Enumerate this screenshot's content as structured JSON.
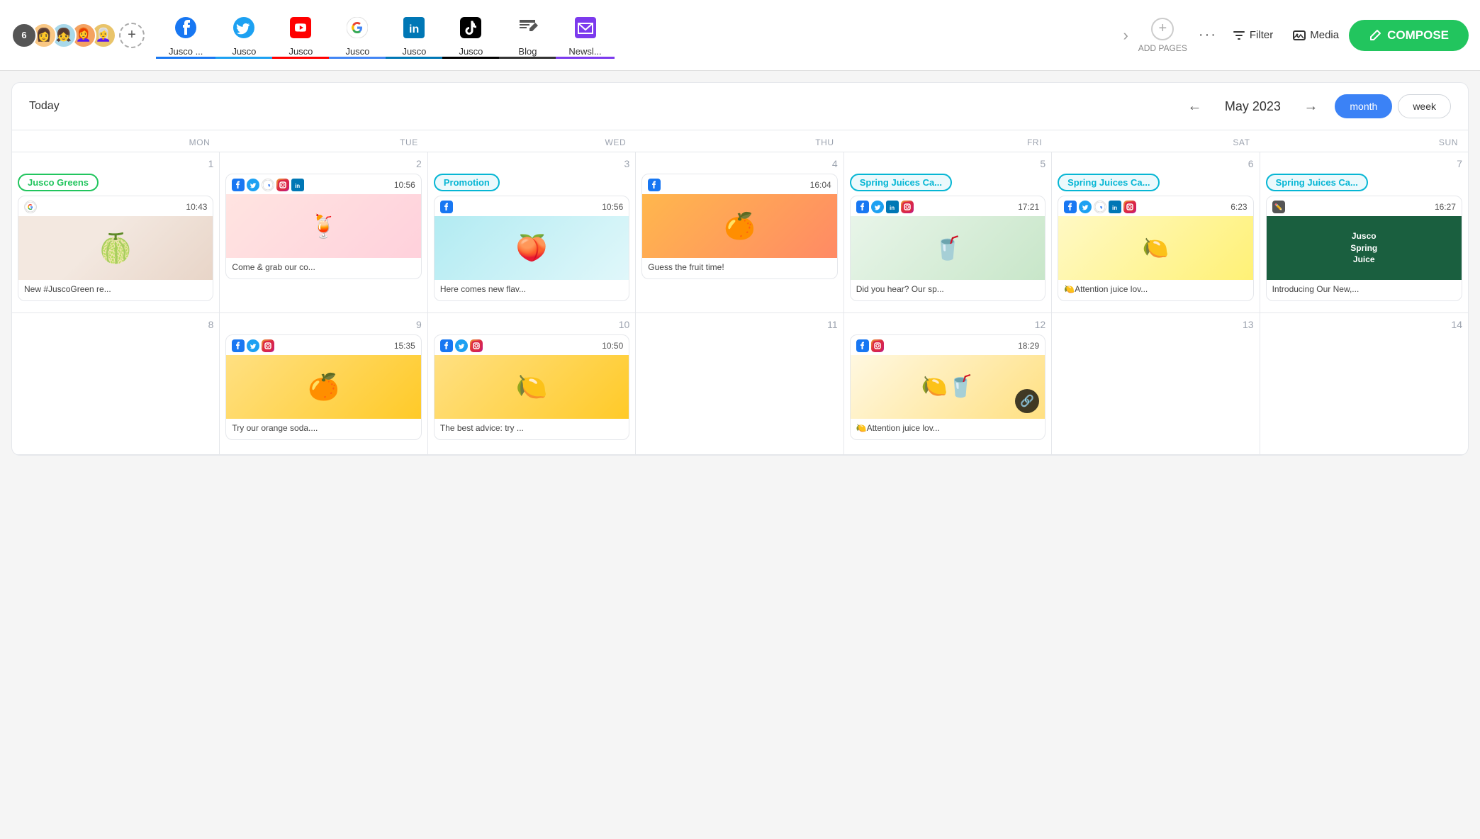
{
  "avatars": {
    "count": "6",
    "users": [
      "👩",
      "👧",
      "👩‍🦰",
      "👩‍🦳"
    ]
  },
  "tabs": [
    {
      "id": "fb",
      "label": "Jusco ...",
      "icon": "fb",
      "active_class": "active-fb"
    },
    {
      "id": "tw",
      "label": "Jusco",
      "icon": "tw",
      "active_class": "active-tw"
    },
    {
      "id": "yt",
      "label": "Jusco",
      "icon": "yt",
      "active_class": "active-yt"
    },
    {
      "id": "g",
      "label": "Jusco",
      "icon": "g",
      "active_class": "active-g"
    },
    {
      "id": "li",
      "label": "Jusco",
      "icon": "li",
      "active_class": "active-li"
    },
    {
      "id": "tk",
      "label": "Jusco",
      "icon": "tk",
      "active_class": "active-tk"
    },
    {
      "id": "blog",
      "label": "Blog",
      "icon": "blog",
      "active_class": "active-bl"
    },
    {
      "id": "nl",
      "label": "Newsl...",
      "icon": "nl",
      "active_class": "active-nl"
    }
  ],
  "nav": {
    "add_pages": "ADD PAGES",
    "more": "···",
    "filter": "Filter",
    "media": "Media",
    "compose": "COMPOSE"
  },
  "calendar": {
    "today": "Today",
    "month_year": "May 2023",
    "view_month": "month",
    "view_week": "week",
    "days": [
      "MON",
      "TUE",
      "WED",
      "THU",
      "FRI",
      "SAT",
      "SUN"
    ],
    "week1_nums": [
      "1",
      "2",
      "3",
      "4",
      "5",
      "6",
      "7"
    ],
    "week2_nums": [
      "8",
      "9",
      "10",
      "11",
      "12",
      "13",
      "14"
    ]
  },
  "posts": {
    "w1_mon": {
      "tag": "Jusco Greens",
      "tag_type": "green",
      "platform": "google",
      "time": "10:43",
      "caption": "New #JuscoGreen re...",
      "img_type": "fig"
    },
    "w1_tue": {
      "platforms": [
        "fb",
        "tw",
        "g",
        "ig",
        "li"
      ],
      "time": "10:56",
      "caption": "Come & grab our co...",
      "img_type": "drinks"
    },
    "w1_wed_tag": "Promotion",
    "w1_wed": {
      "platform": "fb",
      "time": "10:56",
      "caption": "Here comes new flav...",
      "img_type": "peach"
    },
    "w1_thu": {
      "platform": "fb",
      "time": "16:04",
      "caption": "Guess the fruit time!",
      "img_type": "grapefruit"
    },
    "w1_fri_tag": "Spring Juices Ca...",
    "w1_fri": {
      "platforms": [
        "fb",
        "tw",
        "li",
        "ig"
      ],
      "time": "17:21",
      "caption": "Did you hear? Our sp...",
      "img_type": "smoothies"
    },
    "w1_sat_tag": "Spring Juices Ca...",
    "w1_sat": {
      "platforms": [
        "fb",
        "tw",
        "g",
        "li",
        "ig"
      ],
      "time": "6:23",
      "caption": "🍋Attention juice lov...",
      "img_type": "juices"
    },
    "w1_sun_tag": "Spring Juices Ca...",
    "w1_sun": {
      "platform": "blog",
      "time": "16:27",
      "caption": "Introducing Our New,...",
      "img_type": "spring_juice"
    },
    "w2_tue": {
      "platforms": [
        "fb",
        "tw",
        "ig"
      ],
      "time": "15:35",
      "caption": "Try our orange soda....",
      "img_type": "orange_slices"
    },
    "w2_wed": {
      "platforms": [
        "fb",
        "tw",
        "ig"
      ],
      "time": "10:50",
      "caption": "The best advice: try ...",
      "img_type": "lemon"
    },
    "w2_fri": {
      "platforms": [
        "fb",
        "ig"
      ],
      "time": "18:29",
      "caption": "🍋Attention juice lov...",
      "img_type": "lemonade"
    }
  }
}
